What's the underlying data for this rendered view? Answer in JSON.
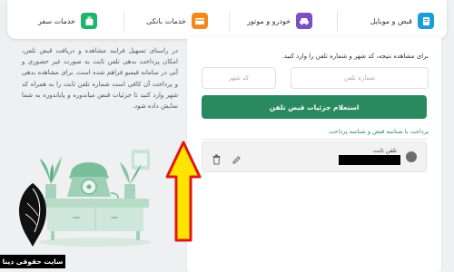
{
  "nav": {
    "bills": "قبض و موبایل",
    "vehicle": "خودرو و موتور",
    "banking": "خدمات بانکی",
    "travel": "خدمات سفر"
  },
  "intro": {
    "text": "در راستای تسهیل فرایند مشاهده و دریافت قبض تلفن، امکان پرداخت بدهی تلفن ثابت به صورت غیر حضوری و آنی در سامانه فیمبو فراهم شده است. برای مشاهده بدهی و پرداخت آن کافی است شماره تلفن ثابت را به همراه کد شهر وارد کنید تا جزئیات قبض میاندوره و پایاندوره به شما نمایش داده شود."
  },
  "form": {
    "instruction": "برای مشاهده نتیجه، کد شهر و شماره تلفن را وارد کنید.",
    "phone_placeholder": "شماره تلفن",
    "city_placeholder": "کد شهر",
    "submit_label": "استعلام جزئیات قبض تلفن",
    "section_title": "پرداخت با شناسه قبض و شناسه پرداخت"
  },
  "saved_item": {
    "label": "تلفن ثابت"
  },
  "watermark": {
    "text": "سایت حقوقی دینا"
  },
  "colors": {
    "primary": "#2a8a5f",
    "arrow_fill": "#ffe400",
    "arrow_stroke": "#e01717"
  }
}
